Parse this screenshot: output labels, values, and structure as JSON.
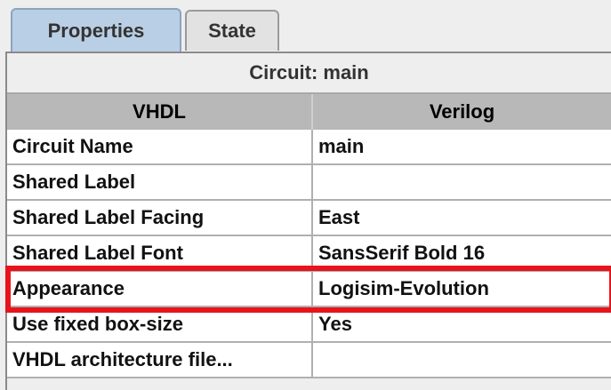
{
  "tabs": [
    {
      "label": "Properties",
      "selected": true
    },
    {
      "label": "State",
      "selected": false
    }
  ],
  "table": {
    "title": "Circuit: main",
    "columns": [
      "VHDL",
      "Verilog"
    ],
    "rows": [
      {
        "name": "Circuit Name",
        "value": "main"
      },
      {
        "name": "Shared Label",
        "value": ""
      },
      {
        "name": "Shared Label Facing",
        "value": "East"
      },
      {
        "name": "Shared Label Font",
        "value": "SansSerif Bold 16"
      },
      {
        "name": "Appearance",
        "value": "Logisim-Evolution"
      },
      {
        "name": "Use fixed box-size",
        "value": "Yes"
      },
      {
        "name": "VHDL architecture file...",
        "value": ""
      }
    ]
  },
  "highlight": {
    "color": "#e8141c",
    "row": "Appearance"
  },
  "colors": {
    "tab_selected": "#b9cfe5",
    "header_bg": "#b8b8b8",
    "cell_bg": "#ffffff"
  }
}
